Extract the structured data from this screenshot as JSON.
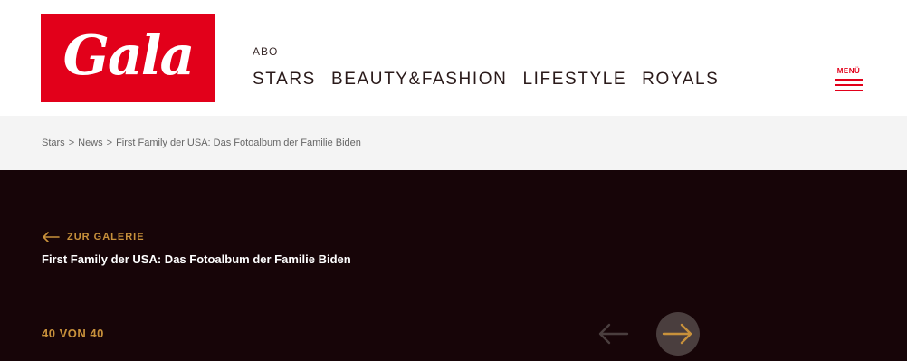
{
  "logo": {
    "text": "Gala"
  },
  "nav": {
    "abo": "ABO",
    "items": [
      "STARS",
      "BEAUTY&FASHION",
      "LIFESTYLE",
      "ROYALS"
    ]
  },
  "menu": {
    "label": "MENÜ"
  },
  "breadcrumb": {
    "items": [
      "Stars",
      "News",
      "First Family der USA: Das Fotoalbum der Familie Biden"
    ],
    "separator": ">"
  },
  "gallery": {
    "back_label": "ZUR GALERIE",
    "title": "First Family der USA: Das Fotoalbum der Familie Biden",
    "counter": "40 VON 40"
  },
  "colors": {
    "brand_red": "#e2001a",
    "gold": "#c8913b",
    "dark_bg": "#170508",
    "breadcrumb_bg": "#f4f4f4"
  },
  "icons": {
    "back": "arrow-left-icon",
    "prev": "arrow-left-icon",
    "next": "arrow-right-icon"
  }
}
